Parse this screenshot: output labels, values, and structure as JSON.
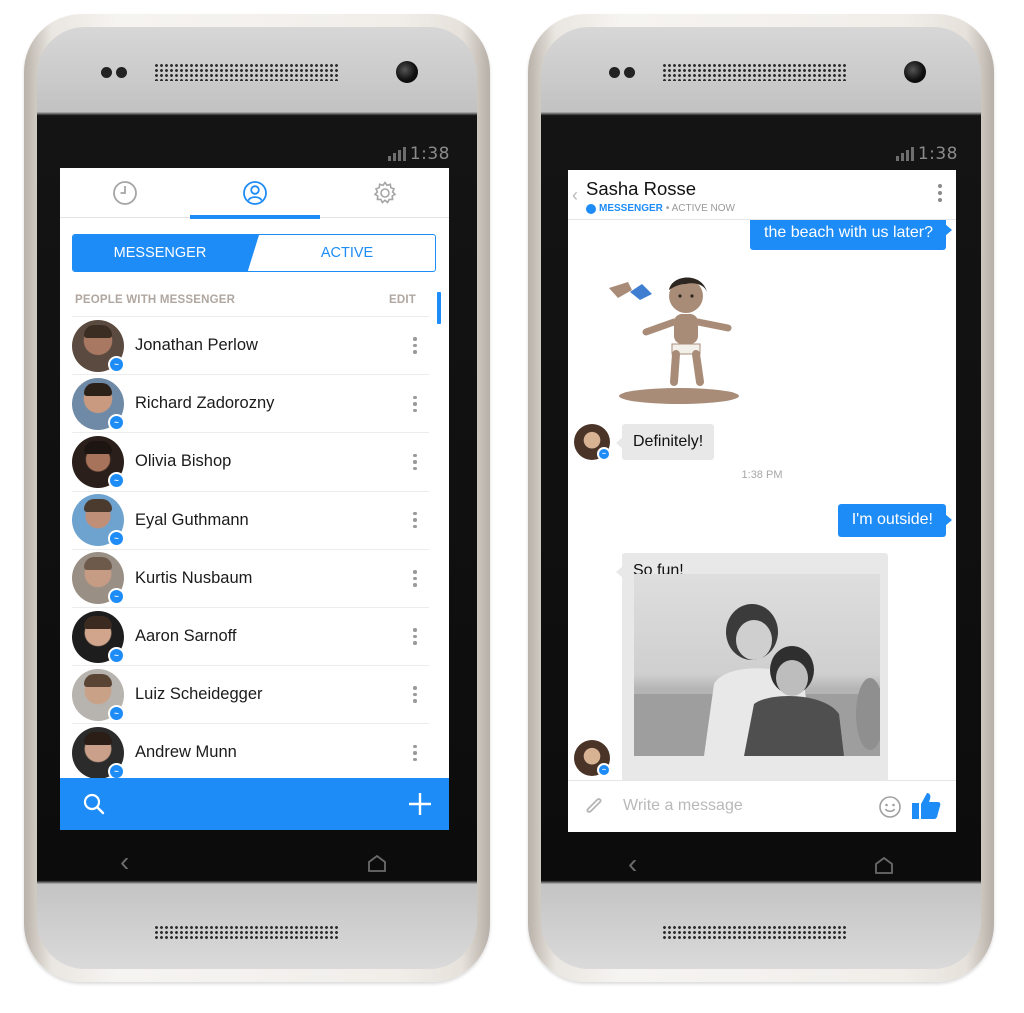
{
  "left_phone": {
    "status_time": "1:38",
    "tabs": [
      {
        "icon": "clock-icon"
      },
      {
        "icon": "person-icon"
      },
      {
        "icon": "gear-icon"
      }
    ],
    "segment": {
      "messenger_label": "MESSENGER",
      "active_label": "ACTIVE"
    },
    "section_title": "PEOPLE WITH MESSENGER",
    "edit_label": "EDIT",
    "people": [
      {
        "name": "Jonathan Perlow"
      },
      {
        "name": "Richard Zadorozny"
      },
      {
        "name": "Olivia Bishop"
      },
      {
        "name": "Eyal Guthmann"
      },
      {
        "name": "Kurtis Nusbaum"
      },
      {
        "name": "Aaron Sarnoff"
      },
      {
        "name": "Luiz Scheidegger"
      },
      {
        "name": "Andrew Munn"
      }
    ],
    "bottom_bar": {
      "search_icon": "search-icon",
      "add_icon": "plus-icon"
    }
  },
  "right_phone": {
    "status_time": "1:38",
    "header": {
      "contact_name": "Sasha Rosse",
      "app_label": "MESSENGER",
      "status_label": "• ACTIVE NOW"
    },
    "messages": {
      "outgoing_1": "the beach with us later?",
      "incoming_1": "Definitely!",
      "timestamp": "1:38 PM",
      "outgoing_2": "I'm outside!",
      "incoming_2": "So fun!"
    },
    "composer": {
      "placeholder": "Write a message"
    }
  },
  "colors": {
    "accent": "#1e8cf6",
    "incoming_bubble": "#e8e8e8",
    "section_label": "#b0a7a0"
  }
}
